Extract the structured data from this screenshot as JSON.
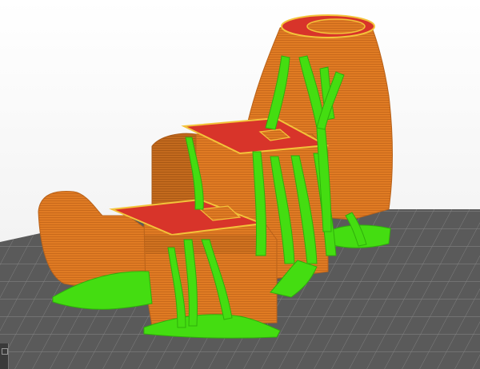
{
  "viewport": {
    "description_name": "3d-slice-preview",
    "colors": {
      "background": "#ffffff",
      "bed": "#5a5a5a",
      "bed_grid": "#8a8a8a",
      "perimeter": "#e07b23",
      "perimeter_dark": "#b8621a",
      "infill": "#d8342a",
      "top_edge": "#f3c33a",
      "support": "#44dd11",
      "support_dark": "#2fae0b"
    }
  }
}
